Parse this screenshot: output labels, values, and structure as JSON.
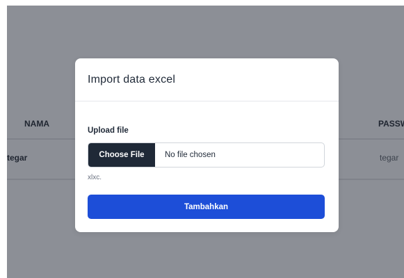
{
  "background_table": {
    "headers": {
      "nama": "NAMA",
      "password": "PASSW"
    },
    "rows": [
      {
        "nama": "tegar",
        "password": "tegar"
      }
    ]
  },
  "modal": {
    "title": "Import data excel",
    "upload_label": "Upload file",
    "choose_file_label": "Choose File",
    "file_status": "No file chosen",
    "hint": "xlxc.",
    "submit_label": "Tambahkan"
  },
  "colors": {
    "overlay": "#8c8f96",
    "primary_button": "#1d4ed8",
    "file_button": "#1f2937"
  }
}
